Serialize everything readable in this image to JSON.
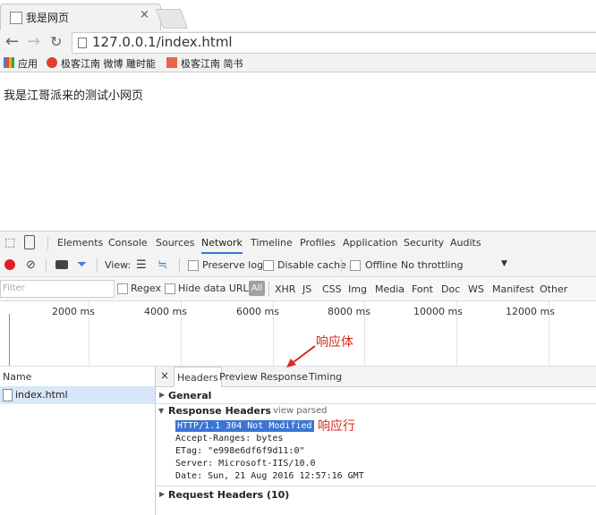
{
  "browser": {
    "tab_title": "我是网页",
    "tab_close": "×",
    "url": "127.0.0.1/index.html",
    "bookmarks": [
      "应用",
      "极客江南 微博 雕时能",
      "极客江南 简书"
    ]
  },
  "page": {
    "text": "我是江哥派来的测试小网页"
  },
  "devtools": {
    "tabs": [
      "Elements",
      "Console",
      "Sources",
      "Network",
      "Timeline",
      "Profiles",
      "Application",
      "Security",
      "Audits"
    ],
    "active_tab": "Network",
    "toolbar": {
      "view_label": "View:",
      "preserve_log": "Preserve log",
      "disable_cache": "Disable cache",
      "offline": "Offline",
      "throttling": "No throttling",
      "dropdown": "▼"
    },
    "filter": {
      "placeholder": "Filter",
      "regex": "Regex",
      "hide_data_urls": "Hide data URLs",
      "types": [
        "All",
        "XHR",
        "JS",
        "CSS",
        "Img",
        "Media",
        "Font",
        "Doc",
        "WS",
        "Manifest",
        "Other"
      ]
    },
    "timeline_labels": [
      "2000 ms",
      "4000 ms",
      "6000 ms",
      "8000 ms",
      "10000 ms",
      "12000 ms"
    ],
    "requests": {
      "header": "Name",
      "rows": [
        "index.html"
      ]
    },
    "detail": {
      "close": "×",
      "tabs": [
        "Headers",
        "Preview",
        "Response",
        "Timing"
      ],
      "general": "General",
      "response_headers": "Response Headers",
      "view_parsed": "view parsed",
      "status_line": "HTTP/1.1 304 Not Modified",
      "headers": [
        "Accept-Ranges: bytes",
        "ETag: \"e998e6df6f9d11:0\"",
        "Server: Microsoft-IIS/10.0",
        "Date: Sun, 21 Aug 2016 12:57:16 GMT"
      ],
      "request_headers": "Request Headers (10)"
    },
    "annotations": {
      "response_body": "响应体",
      "response_line": "响应行"
    }
  }
}
